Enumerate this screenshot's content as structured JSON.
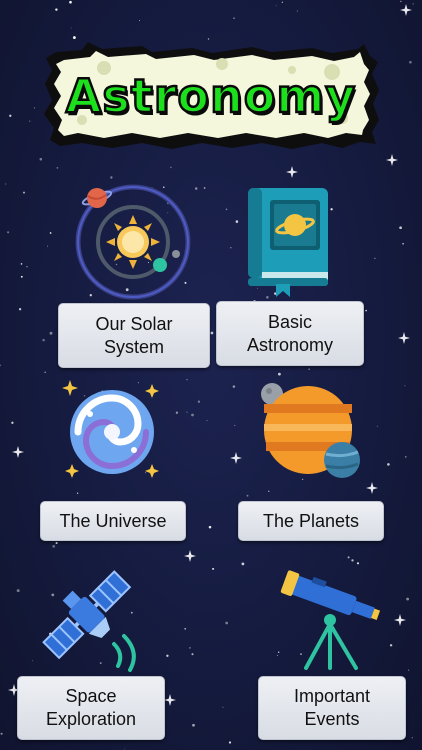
{
  "app": {
    "title": "Astronomy"
  },
  "colors": {
    "title_text": "#1de01d",
    "title_plaque": "#f4f7dc",
    "background": "#151b3f",
    "button_bg": "#e4e7ed"
  },
  "tiles": [
    {
      "icon": "solar-system-icon",
      "line1": "Our Solar",
      "line2": "System"
    },
    {
      "icon": "astronomy-book-icon",
      "line1": "Basic",
      "line2": "Astronomy"
    },
    {
      "icon": "galaxy-icon",
      "line1": "The Universe",
      "line2": ""
    },
    {
      "icon": "planets-icon",
      "line1": "The Planets",
      "line2": ""
    },
    {
      "icon": "satellite-icon",
      "line1": "Space",
      "line2": "Exploration"
    },
    {
      "icon": "telescope-icon",
      "line1": "Important",
      "line2": "Events"
    }
  ]
}
